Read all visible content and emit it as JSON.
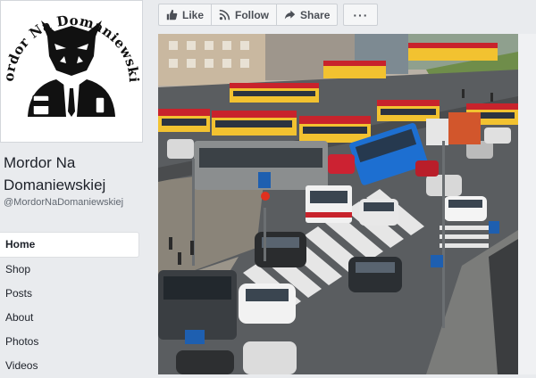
{
  "page": {
    "name": "Mordor Na Domaniewskiej",
    "handle": "@MordorNaDomaniewskiej",
    "logo_text": "Mordor Na Domaniewskiej"
  },
  "actions": {
    "like": "Like",
    "follow": "Follow",
    "share": "Share",
    "more": "···"
  },
  "nav": [
    {
      "label": "Home",
      "active": true
    },
    {
      "label": "Shop"
    },
    {
      "label": "Posts"
    },
    {
      "label": "About"
    },
    {
      "label": "Photos"
    },
    {
      "label": "Videos"
    }
  ],
  "icons": {
    "like": "thumbs-up-icon",
    "follow": "rss-icon",
    "share": "share-arrow-icon"
  },
  "colors": {
    "page_bg": "#e9ebee",
    "bus_yellow": "#f2c230",
    "bus_red": "#c8232c",
    "bus_blue": "#1d6fd1"
  }
}
